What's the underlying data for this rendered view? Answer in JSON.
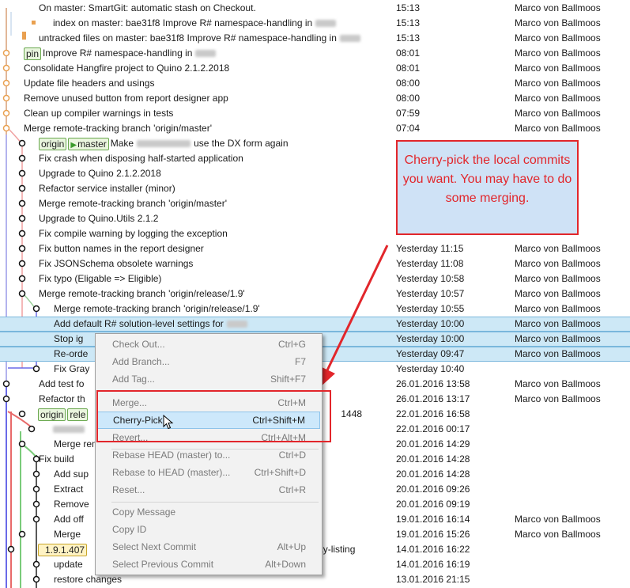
{
  "rows": [
    {
      "message": "On master: SmartGit: automatic stash on Checkout.",
      "date": "15:13",
      "author": "Marco von Ballmoos"
    },
    {
      "message": "index on master: bae31f8 Improve R# namespace-handling in",
      "date": "15:13",
      "author": "Marco von Ballmoos"
    },
    {
      "message": "untracked files on master: bae31f8 Improve R# namespace-handling in",
      "date": "15:13",
      "author": "Marco von Ballmoos"
    },
    {
      "message": "Improve R# namespace-handling in",
      "date": "08:01",
      "author": "Marco von Ballmoos",
      "badge": "pin"
    },
    {
      "message": "Consolidate Hangfire project to Quino 2.1.2.2018",
      "date": "08:01",
      "author": "Marco von Ballmoos"
    },
    {
      "message": "Update file headers and usings",
      "date": "08:00",
      "author": "Marco von Ballmoos"
    },
    {
      "message": "Remove unused button from report designer app",
      "date": "08:00",
      "author": "Marco von Ballmoos"
    },
    {
      "message": "Clean up compiler warnings in tests",
      "date": "07:59",
      "author": "Marco von Ballmoos"
    },
    {
      "message": "Merge remote-tracking branch 'origin/master'",
      "date": "07:04",
      "author": "Marco von Ballmoos"
    },
    {
      "message": "Make",
      "message2": "use the DX form again",
      "date": "",
      "author": "",
      "badge": "origin",
      "badge2": "master"
    },
    {
      "message": "Fix crash when disposing half-started application",
      "date": "",
      "author": ""
    },
    {
      "message": "Upgrade to Quino 2.1.2.2018",
      "date": "",
      "author": ""
    },
    {
      "message": "Refactor service installer (minor)",
      "date": "",
      "author": ""
    },
    {
      "message": "Merge remote-tracking branch 'origin/master'",
      "date": "",
      "author": ""
    },
    {
      "message": "Upgrade to Quino.Utils 2.1.2",
      "date": "",
      "author": ""
    },
    {
      "message": "Fix compile warning by logging the exception",
      "date": "",
      "author": ""
    },
    {
      "message": "Fix button names in the report designer",
      "date": "Yesterday 11:15",
      "author": "Marco von Ballmoos"
    },
    {
      "message": "Fix JSONSchema obsolete warnings",
      "date": "Yesterday 11:08",
      "author": "Marco von Ballmoos"
    },
    {
      "message": "Fix typo (Eligable => Eligible)",
      "date": "Yesterday 10:58",
      "author": "Marco von Ballmoos"
    },
    {
      "message": "Merge remote-tracking branch 'origin/release/1.9'",
      "date": "Yesterday 10:57",
      "author": "Marco von Ballmoos"
    },
    {
      "message": "Merge remote-tracking branch 'origin/release/1.9'",
      "date": "Yesterday 10:55",
      "author": "Marco von Ballmoos"
    },
    {
      "message": "Add default R# solution-level settings for",
      "date": "Yesterday 10:00",
      "author": "Marco von Ballmoos",
      "selected": true
    },
    {
      "message": "Stop ig",
      "date": "Yesterday 10:00",
      "author": "Marco von Ballmoos",
      "selected": true
    },
    {
      "message": "Re-orde",
      "date": "Yesterday 09:47",
      "author": "Marco von Ballmoos",
      "selected": true
    },
    {
      "message": "Fix Gray",
      "date": "Yesterday 10:40",
      "author": ""
    },
    {
      "message": "Add test fo",
      "date": "26.01.2016 13:58",
      "author": "Marco von Ballmoos"
    },
    {
      "message": "Refactor th",
      "date": "26.01.2016 13:17",
      "author": "Marco von Ballmoos"
    },
    {
      "message": "1448",
      "date": "22.01.2016 16:58",
      "author": "",
      "badge": "origin",
      "badge2": "rele"
    },
    {
      "message": "",
      "date": "22.01.2016 00:17",
      "author": ""
    },
    {
      "message": "Merge rem",
      "date": "20.01.2016 14:29",
      "author": ""
    },
    {
      "message": "Fix build",
      "date": "20.01.2016 14:28",
      "author": ""
    },
    {
      "message": "Add sup",
      "date": "20.01.2016 14:28",
      "author": ""
    },
    {
      "message": "Extract",
      "date": "20.01.2016 09:26",
      "author": ""
    },
    {
      "message": "Remove",
      "date": "20.01.2016 09:19",
      "author": ""
    },
    {
      "message": "Add off",
      "date": "19.01.2016 16:14",
      "author": "Marco von Ballmoos"
    },
    {
      "message": "Merge",
      "date": "19.01.2016 15:26",
      "author": "Marco von Ballmoos"
    },
    {
      "message": "ay-listing",
      "date": "14.01.2016 16:22",
      "author": "",
      "badge": "1.9.1.407",
      "tag": true
    },
    {
      "message": "update",
      "date": "14.01.2016 16:19",
      "author": ""
    },
    {
      "message": "restore changes",
      "date": "13.01.2016 21:15",
      "author": ""
    }
  ],
  "callout": "Cherry-pick the local commits you want. You may have to do some merging.",
  "menu": {
    "check_out": {
      "label": "Check Out...",
      "shortcut": "Ctrl+G"
    },
    "add_branch": {
      "label": "Add Branch...",
      "shortcut": "F7"
    },
    "add_tag": {
      "label": "Add Tag...",
      "shortcut": "Shift+F7"
    },
    "merge": {
      "label": "Merge...",
      "shortcut": "Ctrl+M"
    },
    "cherry_pick": {
      "label": "Cherry-Pick...",
      "shortcut": "Ctrl+Shift+M"
    },
    "revert": {
      "label": "Revert...",
      "shortcut": "Ctrl+Alt+M"
    },
    "rebase_to": {
      "label": "Rebase HEAD (master) to...",
      "shortcut": "Ctrl+D"
    },
    "rebase_onto": {
      "label": "Rebase to HEAD (master)...",
      "shortcut": "Ctrl+Shift+D"
    },
    "reset": {
      "label": "Reset...",
      "shortcut": "Ctrl+R"
    },
    "copy_message": {
      "label": "Copy Message",
      "shortcut": ""
    },
    "copy_id": {
      "label": "Copy ID",
      "shortcut": ""
    },
    "select_next": {
      "label": "Select Next Commit",
      "shortcut": "Alt+Up"
    },
    "select_prev": {
      "label": "Select Previous Commit",
      "shortcut": "Alt+Down"
    }
  },
  "colors": {
    "accent_red": "#e2262b",
    "selection": "#cde8f6",
    "callout_bg": "#cfe2f6"
  }
}
